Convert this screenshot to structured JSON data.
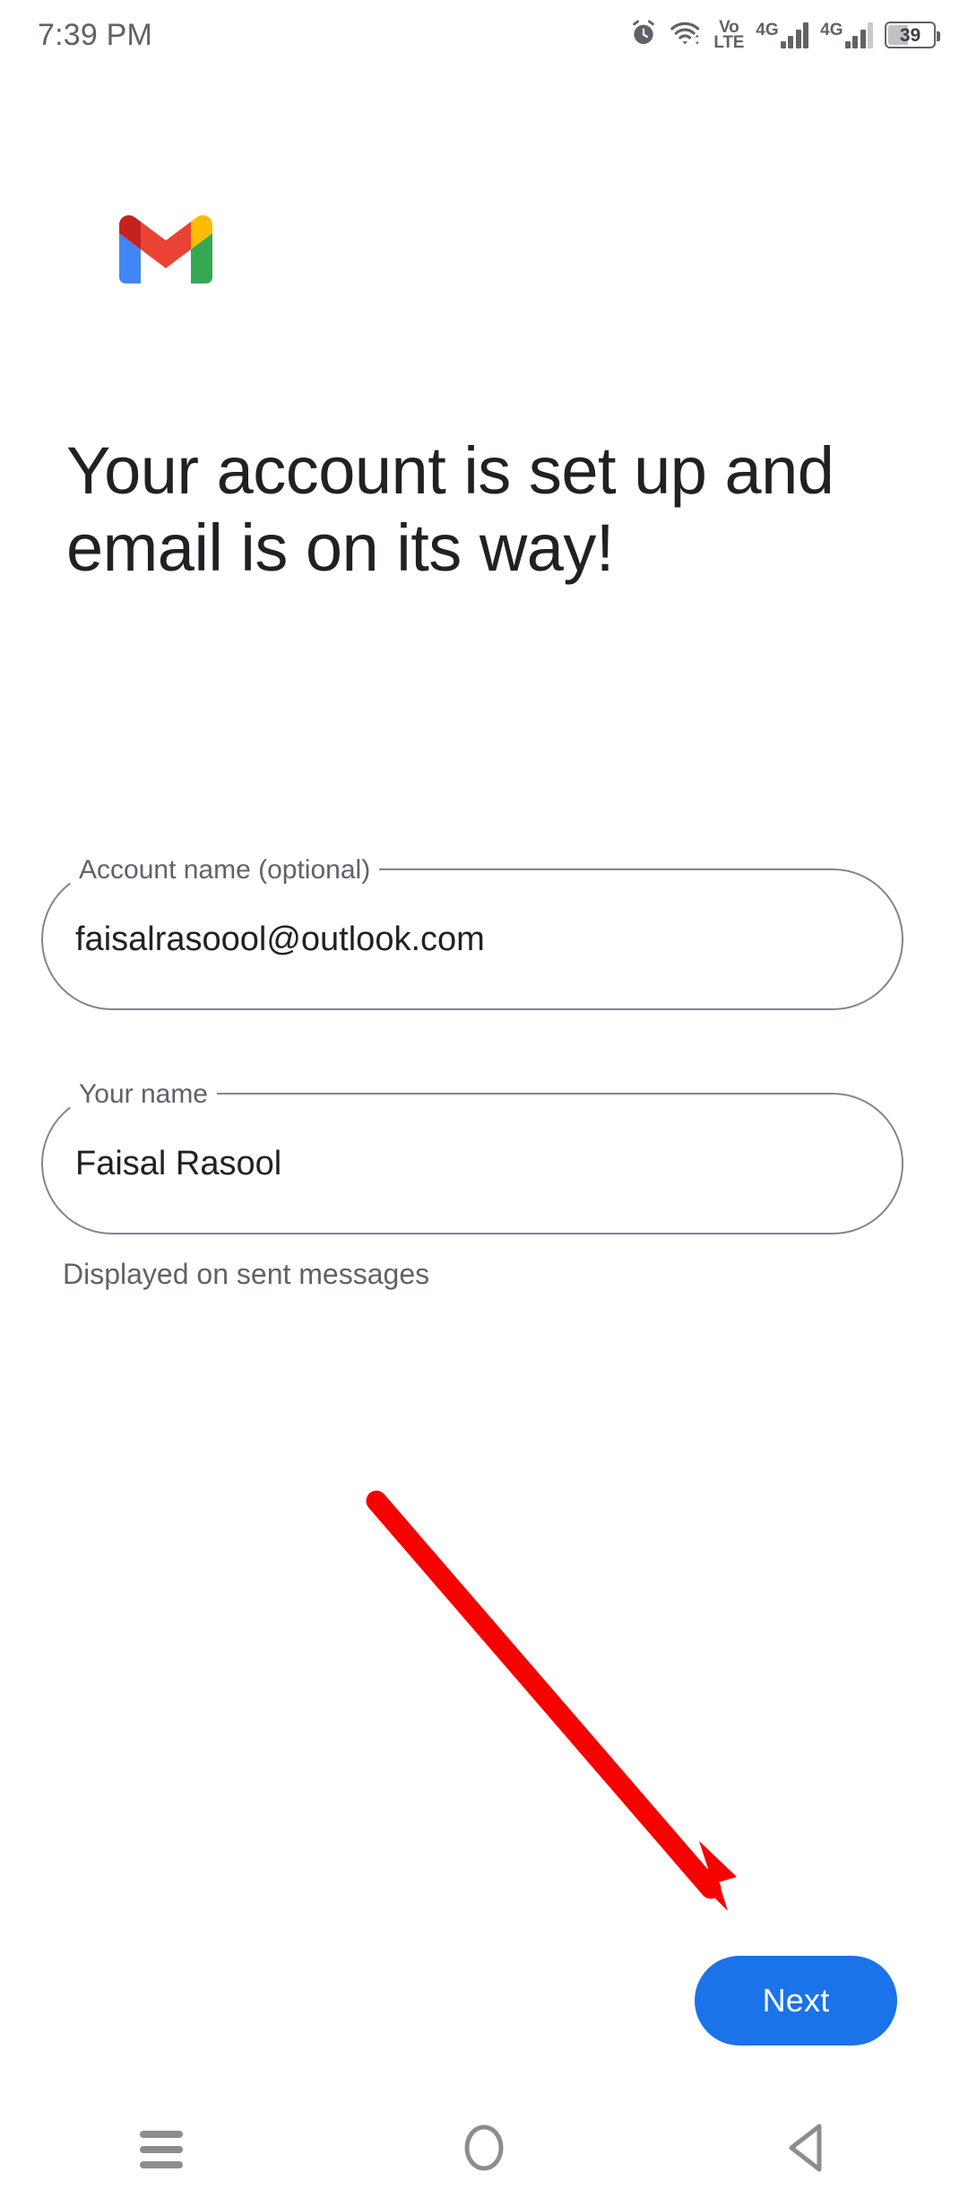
{
  "status_bar": {
    "time": "7:39 PM",
    "icons": [
      {
        "name": "alarm-icon",
        "label": ""
      },
      {
        "name": "wifi-icon",
        "label": ""
      },
      {
        "name": "volte-icon",
        "label_top": "Vo",
        "label_bottom": "LTE"
      },
      {
        "name": "signal-sim1-icon",
        "label": "4G"
      },
      {
        "name": "signal-sim2-icon",
        "label": "4G"
      }
    ],
    "battery": {
      "percent_label": "39",
      "percent": 39
    }
  },
  "app": {
    "logo_name": "gmail-logo",
    "headline": "Your account is set up and email is on its way!"
  },
  "form": {
    "fields": [
      {
        "label": "Account name (optional)",
        "value": "faisalrasoool@outlook.com",
        "placeholder": "Account name (optional)"
      },
      {
        "label": "Your name",
        "value": "Faisal Rasool",
        "placeholder": "Your name"
      }
    ],
    "helper_text": "Displayed on sent messages"
  },
  "actions": {
    "next_label": "Next"
  },
  "annotation": {
    "type": "arrow",
    "color": "#f70000",
    "start": [
      420,
      1673
    ],
    "end": [
      812,
      2128
    ],
    "points_to": "next-button"
  },
  "nav_bar": {
    "recents_label": "Recents",
    "home_label": "Home",
    "back_label": "Back"
  },
  "colors": {
    "accent_blue": "#1a73e8",
    "text_primary": "#202124",
    "text_secondary": "#5f6368",
    "field_outline": "#80868b",
    "annotation_red": "#f70000",
    "background": "#ffffff"
  }
}
